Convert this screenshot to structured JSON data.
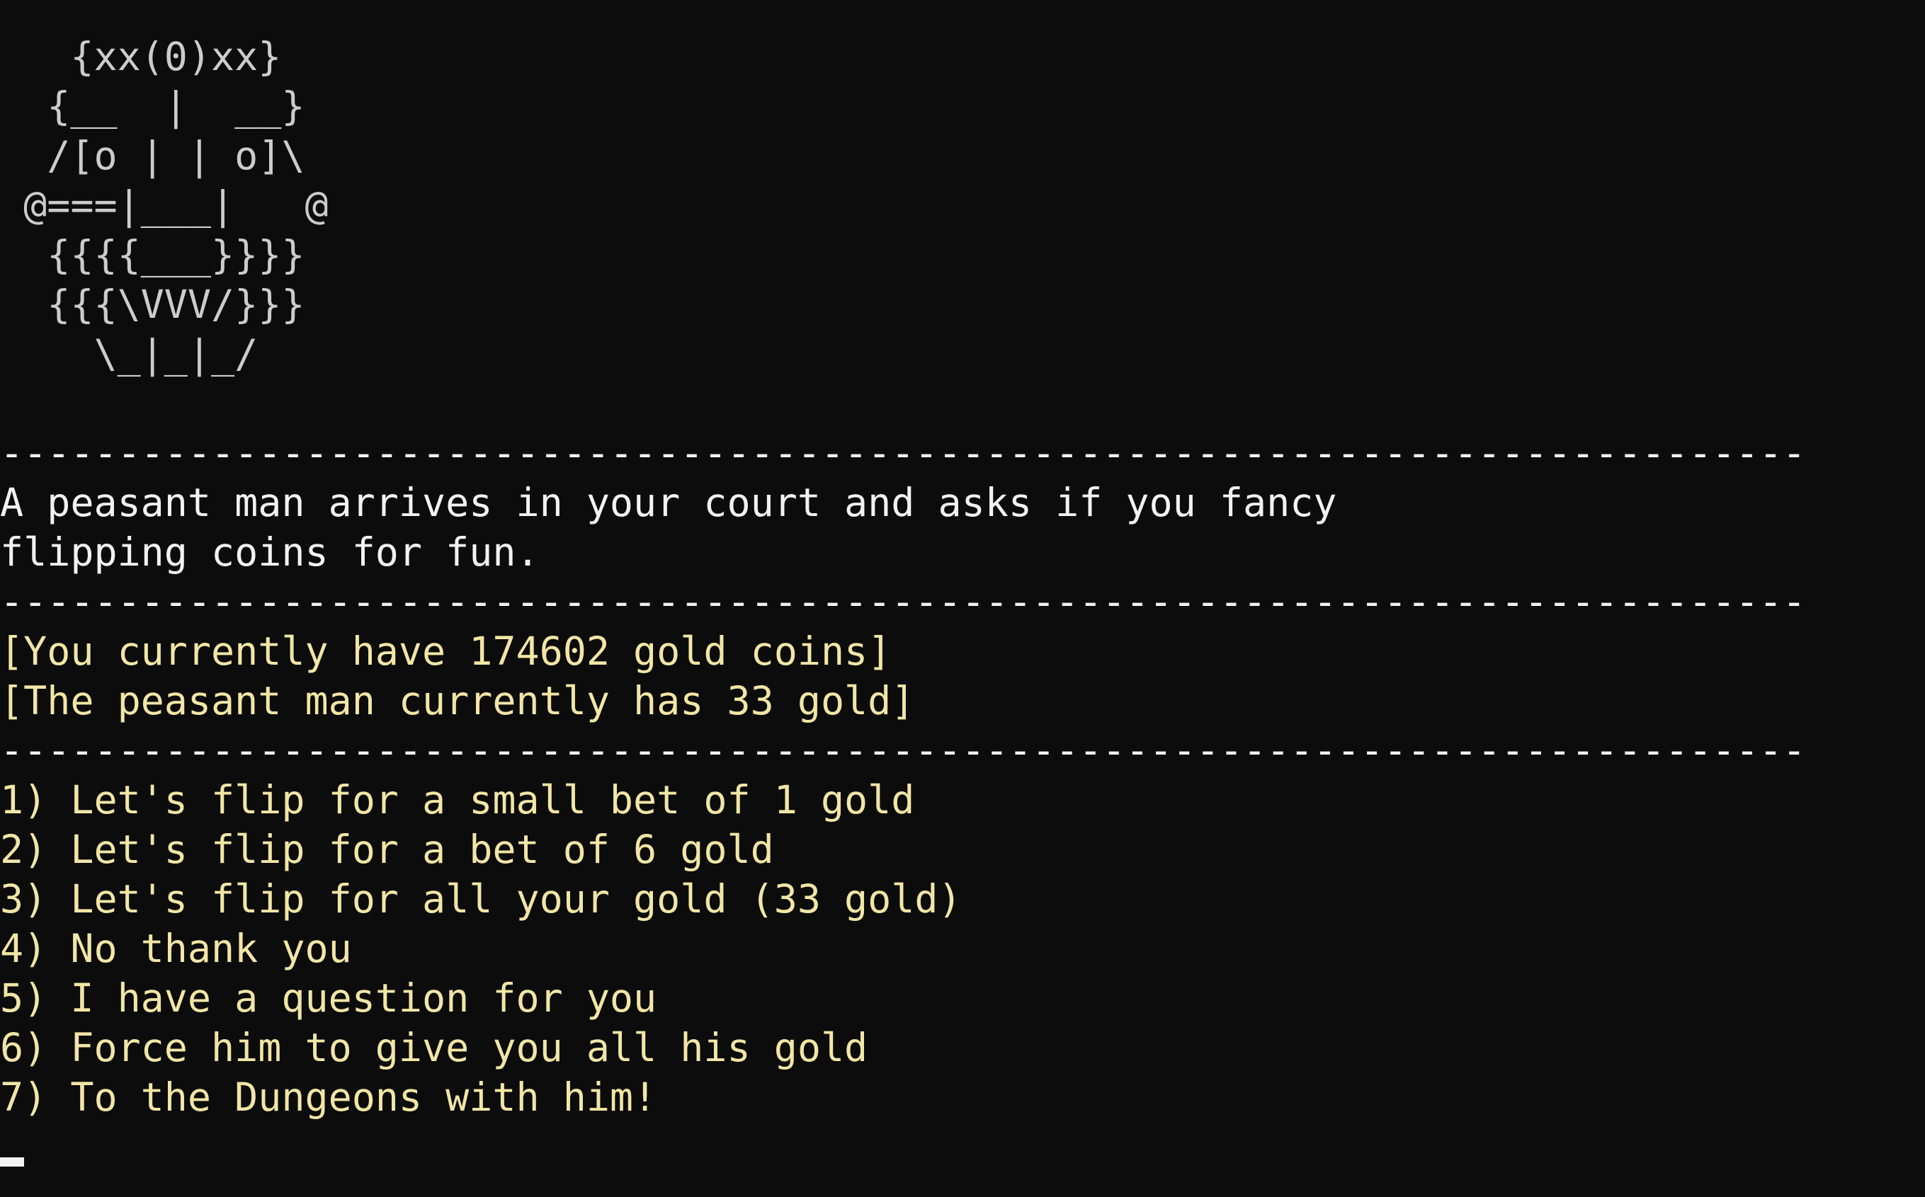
{
  "colors": {
    "background": "#0c0c0c",
    "art": "#cccccc",
    "narration": "#f2f2f2",
    "highlight": "#f2e6a6"
  },
  "ascii_art": [
    "   {xx(0)xx}",
    "  {__  |  __}",
    "  /[o | | o]\\",
    " @===|___|   @",
    "  {{{{___}}}}",
    "  {{{\\VVV/}}}",
    "    \\_|_|_/"
  ],
  "separator": "-----------------------------------------------------------------------------",
  "narration": [
    "A peasant man arrives in your court and asks if you fancy",
    "flipping coins for fun."
  ],
  "status": {
    "player_gold_line": "[You currently have 174602 gold coins]",
    "peasant_gold_line": "[The peasant man currently has 33 gold]"
  },
  "options": [
    "1) Let's flip for a small bet of 1 gold",
    "2) Let's flip for a bet of 6 gold",
    "3) Let's flip for all your gold (33 gold)",
    "4) No thank you",
    "5) I have a question for you",
    "6) Force him to give you all his gold",
    "7) To the Dungeons with him!"
  ]
}
